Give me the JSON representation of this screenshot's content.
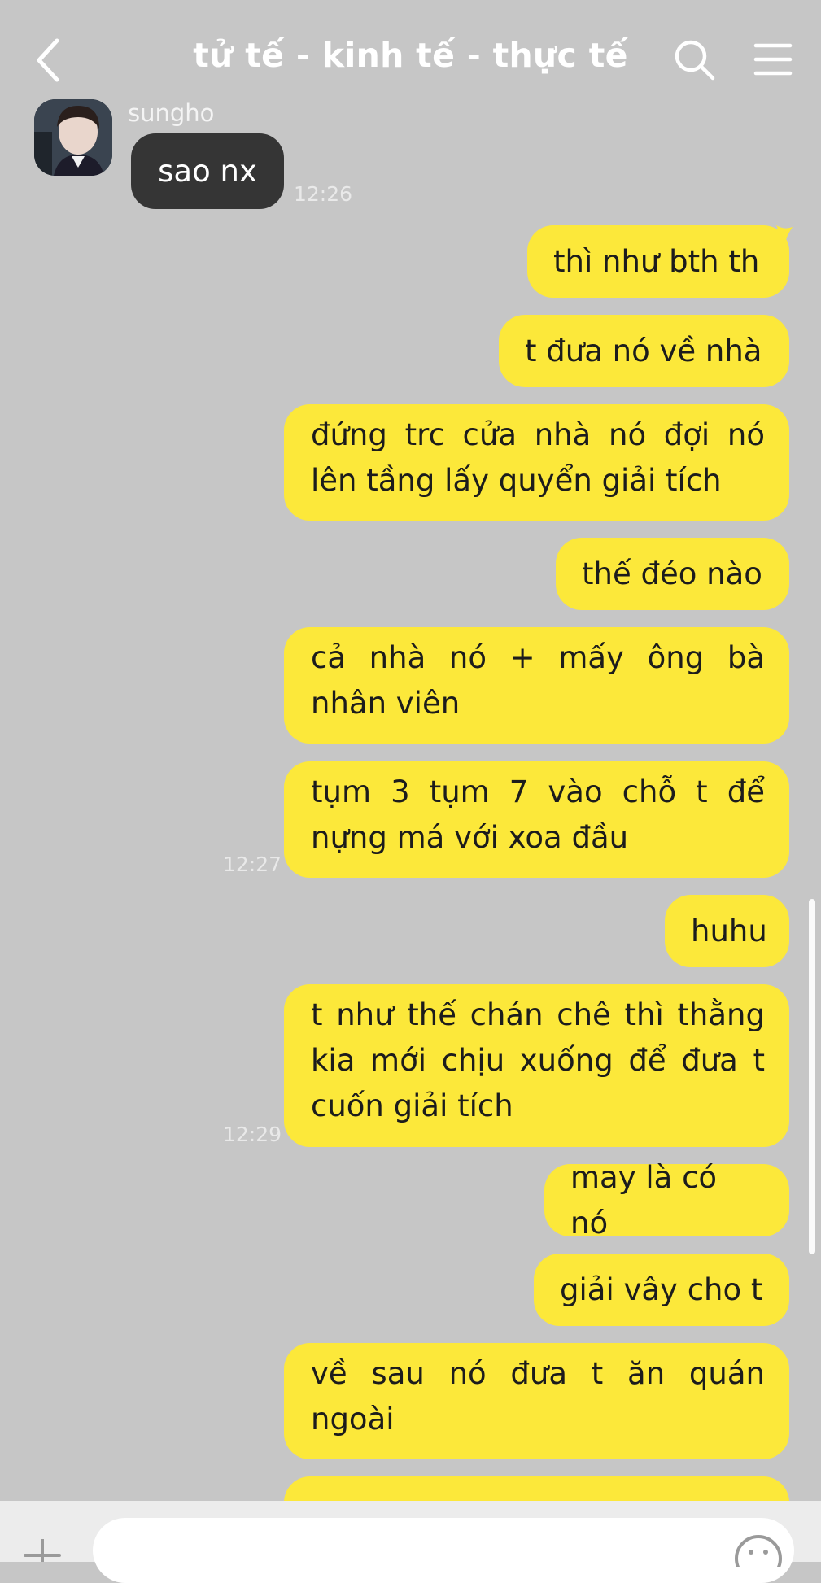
{
  "header": {
    "title": "tử tế - kinh tế - thực tế"
  },
  "incoming": {
    "sender": "sungho",
    "message": "sao nx",
    "time": "12:26"
  },
  "sent": [
    {
      "text": "thì như bth th"
    },
    {
      "text": "t đưa nó về nhà"
    },
    {
      "text": "đứng trc cửa nhà nó đợi nó lên tầng lấy quyển giải tích"
    },
    {
      "text": "thế đéo nào"
    },
    {
      "text": "cả nhà nó + mấy ông bà nhân viên"
    },
    {
      "text": "tụm 3 tụm 7 vào chỗ t để nựng má với xoa đầu"
    },
    {
      "text": "huhu"
    },
    {
      "text": "t như thế chán chê thì thằng kia mới chịu xuống để đưa t cuốn giải tích"
    },
    {
      "text": "may là có nó"
    },
    {
      "text": "giải vây cho t"
    },
    {
      "text": "về sau nó đưa t ăn quán ngoài"
    }
  ],
  "timestamps": {
    "t1": "12:27",
    "t2": "12:29"
  },
  "colors": {
    "background": "#c6c6c6",
    "sent_bubble": "#fce83a",
    "received_bubble": "#353535"
  },
  "icons": {
    "back": "chevron-left-icon",
    "search": "search-icon",
    "menu": "hamburger-menu-icon",
    "plus": "plus-icon",
    "emoji": "emoji-icon"
  }
}
